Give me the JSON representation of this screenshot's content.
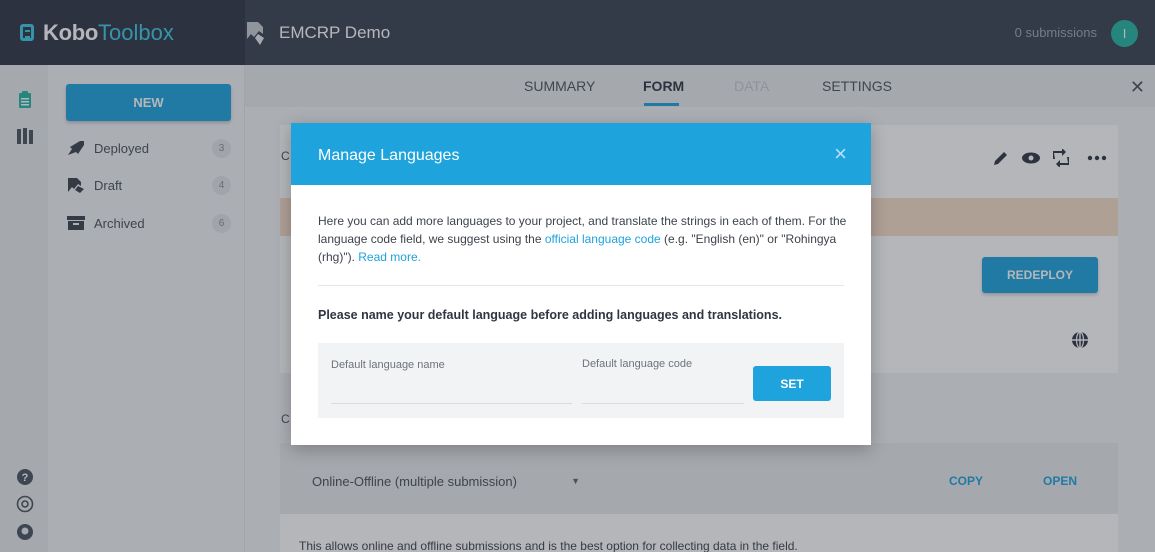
{
  "brand": {
    "part1": "Kobo",
    "part2": "Toolbox"
  },
  "project": {
    "name": "EMCRP Demo"
  },
  "header": {
    "submissions": "0 submissions",
    "avatar_initial": "I"
  },
  "sidebar": {
    "new_label": "NEW",
    "items": [
      {
        "label": "Deployed",
        "count": "3",
        "icon": "rocket-icon"
      },
      {
        "label": "Draft",
        "count": "4",
        "icon": "draft-icon"
      },
      {
        "label": "Archived",
        "count": "6",
        "icon": "archive-icon"
      }
    ]
  },
  "tabs": [
    {
      "label": "SUMMARY",
      "state": "normal"
    },
    {
      "label": "FORM",
      "state": "active"
    },
    {
      "label": "DATA",
      "state": "disabled"
    },
    {
      "label": "SETTINGS",
      "state": "normal"
    }
  ],
  "main": {
    "clip1": "C",
    "clip2": "C",
    "redeploy_label": "REDEPLOY",
    "collect_select": "Online-Offline (multiple submission)",
    "copy_label": "COPY",
    "open_label": "OPEN",
    "description": "This allows online and offline submissions and is the best option for collecting data in the field."
  },
  "modal": {
    "title": "Manage Languages",
    "close": "×",
    "text_part1": "Here you can add more languages to your project, and translate the strings in each of them. For the language code field, we suggest using the ",
    "text_link": "official language code",
    "text_part2": " (e.g. \"English (en)\" or \"Rohingya (rhg)\"). ",
    "read_more": "Read more.",
    "warning": "Please name your default language before adding languages and translations.",
    "name_label": "Default language name",
    "code_label": "Default language code",
    "set_label": "SET"
  },
  "colors": {
    "accent": "#1ea3dd",
    "topbar": "#3a4250",
    "brand_cyan": "#3ecbe5",
    "avatar": "#26b5a4"
  }
}
